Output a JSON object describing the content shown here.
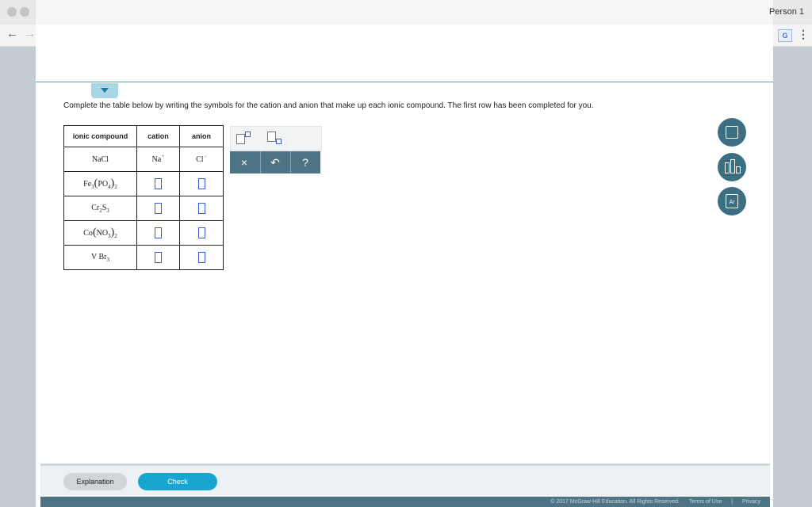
{
  "browser": {
    "profile_name": "Person 1",
    "back_arrow": "←",
    "forward_arrow": "→",
    "translate_glyph": "G",
    "menu_glyph": "⋮"
  },
  "question": {
    "instructions": "Complete the table below by writing the symbols for the cation and anion that make up each ionic compound. The first row has been completed for you."
  },
  "table": {
    "headers": [
      "ionic compound",
      "cation",
      "anion"
    ],
    "rows": [
      {
        "compound": "NaCl",
        "cation": "Na",
        "cation_charge": "+",
        "anion": "Cl",
        "anion_charge": "−"
      },
      {
        "compound_parts": [
          "Fe",
          "3",
          "(",
          "PO",
          "4",
          ")",
          "2"
        ]
      },
      {
        "compound_parts": [
          "Cr",
          "2",
          "S",
          "3"
        ]
      },
      {
        "compound_parts": [
          "Co",
          "(",
          "NO",
          "3",
          ")",
          "2"
        ]
      },
      {
        "compound_parts": [
          "V",
          "Br",
          "3"
        ]
      }
    ]
  },
  "toolbar": {
    "clear_label": "×",
    "undo_label": "↶",
    "help_label": "?"
  },
  "tools": {
    "periodic_label": "Ar"
  },
  "bottom": {
    "explanation_label": "Explanation",
    "check_label": "Check"
  },
  "footer": {
    "copyright": "© 2017 McGraw-Hill Education. All Rights Reserved.",
    "terms": "Terms of Use",
    "separator": "|",
    "privacy": "Privacy"
  }
}
